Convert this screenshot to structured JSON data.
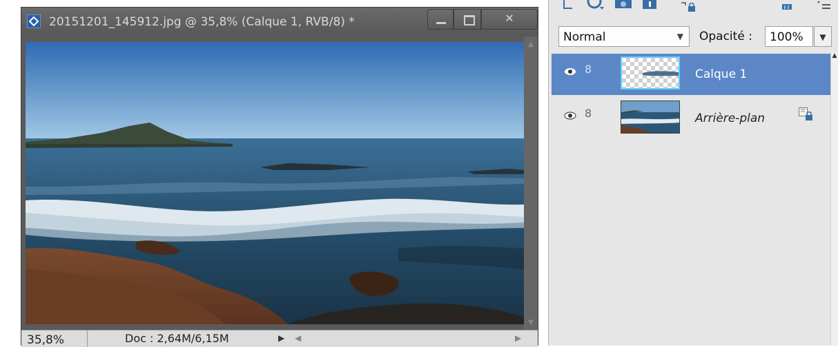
{
  "document": {
    "title": "20151201_145912.jpg @ 35,8% (Calque 1, RVB/8) *",
    "zoom": "35,8%",
    "doc_info": "Doc : 2,64M/6,15M"
  },
  "layers_panel": {
    "blend_mode": "Normal",
    "opacity_label": "Opacité :",
    "opacity_value": "100%",
    "layers": [
      {
        "name": "Calque 1",
        "selected": true,
        "visible": true,
        "locked": false,
        "thumbnail": "transparent"
      },
      {
        "name": "Arrière-plan",
        "selected": false,
        "visible": true,
        "locked": true,
        "thumbnail": "seascape"
      }
    ]
  },
  "colors": {
    "selection": "#5b87c6",
    "thumb_highlight": "#5ad2ff",
    "window_chrome": "#5a5a5a",
    "panel_bg": "#e6e6e6"
  },
  "icons": [
    "document-icon",
    "minimize-icon",
    "maximize-icon",
    "close-icon",
    "new-layer-icon",
    "adjustment-layer-icon",
    "layer-mask-icon",
    "info-icon",
    "lock-icon",
    "delete-icon",
    "panel-menu-icon",
    "eye-icon",
    "link-icon",
    "chevron-down-icon"
  ]
}
